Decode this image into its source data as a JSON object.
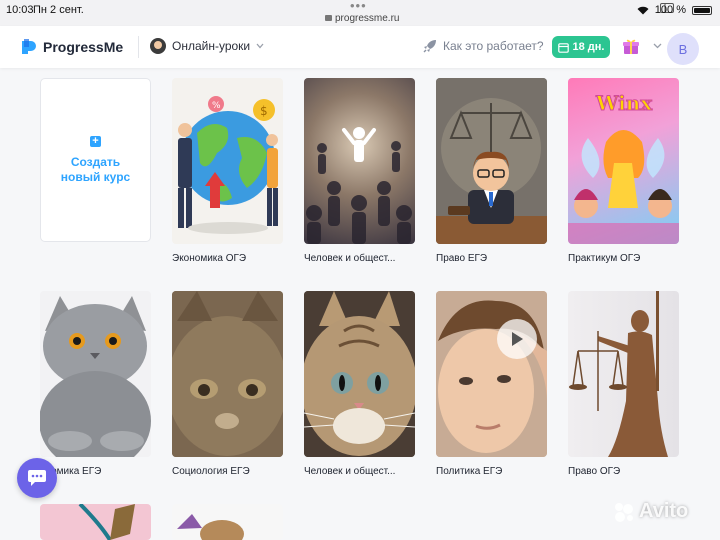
{
  "status_bar": {
    "time": "10:03",
    "date": "Пн 2 сент.",
    "url": "progressme.ru",
    "battery": "100 %"
  },
  "header": {
    "logo": "ProgressMe",
    "nav_item": "Онлайн-уроки",
    "how_it_works": "Как это работает?",
    "trial_days": "18 дн.",
    "user_initial": "В"
  },
  "create_card": {
    "label": "Создать новый курс"
  },
  "courses": [
    {
      "title": "Экономика ОГЭ",
      "image": "globe-economy-illustration"
    },
    {
      "title": "Человек и общест...",
      "image": "crowd-figures"
    },
    {
      "title": "Право ЕГЭ",
      "image": "judge-cartoon"
    },
    {
      "title": "Практикум ОГЭ",
      "image": "winx-poster"
    },
    {
      "title": "ономика ЕГЭ",
      "image": "grey-cat-photo"
    },
    {
      "title": "Социология ЕГЭ",
      "image": "blurry-cat-photo"
    },
    {
      "title": "Человек и общест...",
      "image": "tabby-cat-photo"
    },
    {
      "title": "Политика ЕГЭ",
      "image": "boy-video-thumbnail"
    },
    {
      "title": "Право ОГЭ",
      "image": "lady-justice-statue"
    }
  ],
  "watermark": "Avito",
  "colors": {
    "accent": "#2ea4ff",
    "trial": "#2cc591",
    "chat": "#6c63e8",
    "avatar_bg": "#dfe0fb"
  }
}
